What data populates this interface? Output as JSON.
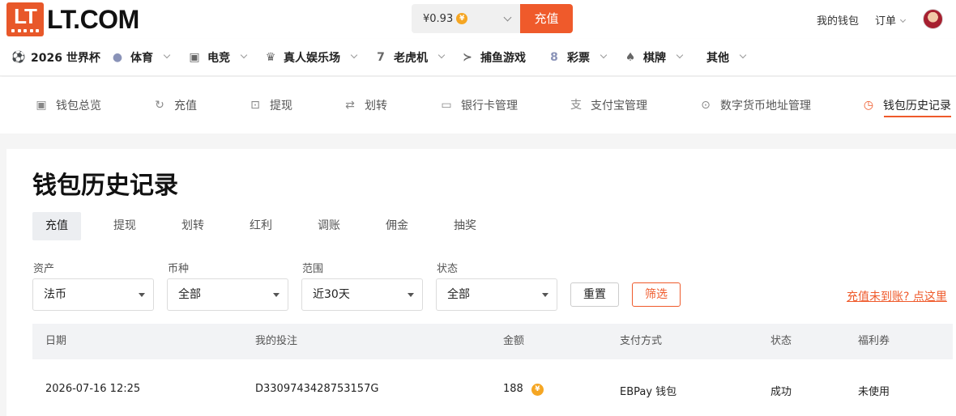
{
  "header": {
    "logo_mark": "LT",
    "logo_text": "LT.COM",
    "balance": "¥0.93",
    "balance_coin": "¥",
    "deposit_label": "充值",
    "wallet_link": "我的钱包",
    "orders_link": "订单"
  },
  "categories": [
    {
      "label": "2026 世界杯",
      "icon": "world-cup-icon",
      "glyph": "⚽"
    },
    {
      "label": "体育",
      "icon": "basketball-icon",
      "glyph": "●"
    },
    {
      "label": "电竞",
      "icon": "gamepad-icon",
      "glyph": "▣"
    },
    {
      "label": "真人娱乐场",
      "icon": "live-casino-icon",
      "glyph": "♛"
    },
    {
      "label": "老虎机",
      "icon": "slot-machine-icon",
      "glyph": "7"
    },
    {
      "label": "捕鱼游戏",
      "icon": "fish-icon",
      "glyph": "≻"
    },
    {
      "label": "彩票",
      "icon": "lottery-icon",
      "glyph": "8"
    },
    {
      "label": "棋牌",
      "icon": "cards-icon",
      "glyph": "♠"
    },
    {
      "label": "其他",
      "icon": "",
      "glyph": ""
    }
  ],
  "wallet_nav": [
    {
      "label": "钱包总览",
      "icon": "wallet-icon",
      "glyph": "▣"
    },
    {
      "label": "充值",
      "icon": "deposit-icon",
      "glyph": "↻"
    },
    {
      "label": "提现",
      "icon": "withdraw-icon",
      "glyph": "⊡"
    },
    {
      "label": "划转",
      "icon": "transfer-icon",
      "glyph": "⇄"
    },
    {
      "label": "银行卡管理",
      "icon": "bank-card-icon",
      "glyph": "▭"
    },
    {
      "label": "支付宝管理",
      "icon": "alipay-icon",
      "glyph": "支"
    },
    {
      "label": "数字货币地址管理",
      "icon": "crypto-address-icon",
      "glyph": "⊙"
    },
    {
      "label": "钱包历史记录",
      "icon": "history-clock-icon",
      "glyph": "◷"
    }
  ],
  "page": {
    "title": "钱包历史记录",
    "tabs": [
      "充值",
      "提现",
      "划转",
      "红利",
      "调账",
      "佣金",
      "抽奖"
    ],
    "active_tab": "充值"
  },
  "filters": {
    "asset": {
      "label": "资产",
      "value": "法币"
    },
    "currency": {
      "label": "币种",
      "value": "全部"
    },
    "range": {
      "label": "范围",
      "value": "近30天"
    },
    "status": {
      "label": "状态",
      "value": "全部"
    },
    "reset_label": "重置",
    "filter_label": "筛选",
    "help_link": "充值未到账? 点这里"
  },
  "table": {
    "columns": [
      "日期",
      "我的投注",
      "金额",
      "支付方式",
      "状态",
      "福利券"
    ],
    "rows": [
      {
        "date": "2026-07-16 12:25",
        "order": "D3309743428753157G",
        "amount": "188",
        "coin": "¥",
        "method": "EBPay 钱包",
        "status": "成功",
        "coupon": "未使用"
      }
    ]
  },
  "colors": {
    "accent": "#ef5a2b",
    "coin": "#f5a623"
  }
}
